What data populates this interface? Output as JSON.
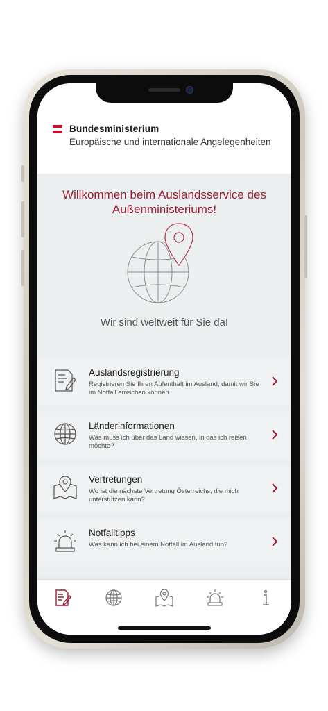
{
  "header": {
    "org_name": "Bundesministerium",
    "org_sub": "Europäische und internationale Angelegenheiten",
    "flag_colors": [
      "#c8102e",
      "#ffffff",
      "#c8102e"
    ]
  },
  "hero": {
    "title": "Willkommen beim Auslandsservice des Außenministeriums!",
    "tagline": "Wir sind weltweit für Sie da!",
    "graphic_icon": "globe-with-location-pin-icon"
  },
  "cards": [
    {
      "title": "Auslandsregistrierung",
      "desc": "Registrieren Sie Ihren Aufenthalt im Ausland, damit wir Sie im Notfall erreichen können.",
      "icon": "registration-form-icon"
    },
    {
      "title": "Länderinformationen",
      "desc": "Was muss ich über das Land wissen, in das ich reisen möchte?",
      "icon": "globe-icon"
    },
    {
      "title": "Vertretungen",
      "desc": "Wo ist die nächste Vertretung Österreichs, die mich unterstützen kann?",
      "icon": "map-pin-icon"
    },
    {
      "title": "Notfalltipps",
      "desc": "Was kann ich bei einem Notfall im Ausland tun?",
      "icon": "siren-icon"
    }
  ],
  "tabbar": {
    "items": [
      {
        "icon": "registration-icon",
        "active": true
      },
      {
        "icon": "globe-icon",
        "active": false
      },
      {
        "icon": "map-icon",
        "active": false
      },
      {
        "icon": "siren-icon",
        "active": false
      },
      {
        "icon": "info-icon",
        "active": false
      }
    ]
  },
  "colors": {
    "accent": "#9e1b32",
    "background": "#eceff0",
    "icon": "#555555"
  }
}
